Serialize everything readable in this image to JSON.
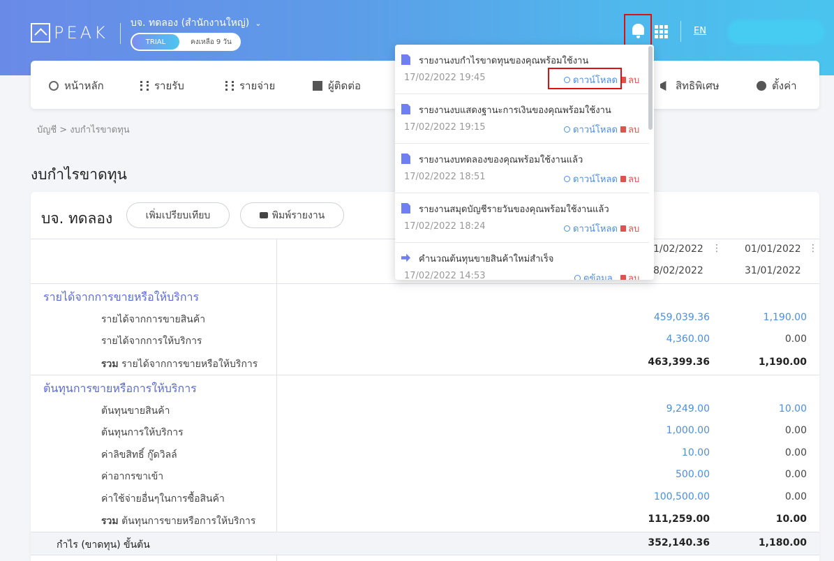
{
  "header": {
    "logo_text": "PEAK",
    "company": "บจ. ทดลอง (สำนักงานใหญ่)",
    "trial_label": "TRIAL",
    "trial_remaining": "คงเหลือ 9 วัน",
    "lang": "EN"
  },
  "nav": {
    "items": [
      {
        "label": "หน้าหลัก",
        "icon": "dashboard-icon"
      },
      {
        "label": "รายรับ",
        "icon": "coins-icon"
      },
      {
        "label": "รายจ่าย",
        "icon": "coins-icon"
      },
      {
        "label": "ผู้ติดต่อ",
        "icon": "building-icon"
      },
      {
        "label": "สิทธิพิเศษ",
        "icon": "megaphone-icon"
      },
      {
        "label": "ตั้งค่า",
        "icon": "gear-icon"
      }
    ]
  },
  "breadcrumb": "บัญชี  >  งบกำไรขาดทุน",
  "page_title": "งบกำไรขาดทุน",
  "report": {
    "company_name": "บจ. ทดลอง",
    "compare_button": "เพิ่มเปรียบเทียบ",
    "print_button": "พิมพ์รายงาน",
    "columns": [
      {
        "from": "1/02/2022",
        "to": "8/02/2022"
      },
      {
        "from": "01/01/2022",
        "to": "31/01/2022"
      }
    ],
    "sections": {
      "revenue": "รายได้จากการขายหรือให้บริการ",
      "cost": "ต้นทุนการขายหรือการให้บริการ"
    },
    "rows": {
      "rev_goods": {
        "label": "รายได้จากการขายสินค้า",
        "v1": "459,039.36",
        "v2": "1,190.00"
      },
      "rev_service": {
        "label": "รายได้จากการให้บริการ",
        "v1": "4,360.00",
        "v2": "0.00"
      },
      "rev_total": {
        "prefix": "รวม",
        "label": "รายได้จากการขายหรือให้บริการ",
        "v1": "463,399.36",
        "v2": "1,190.00"
      },
      "cost_goods": {
        "label": "ต้นทุนขายสินค้า",
        "v1": "9,249.00",
        "v2": "10.00"
      },
      "cost_service": {
        "label": "ต้นทุนการให้บริการ",
        "v1": "1,000.00",
        "v2": "0.00"
      },
      "royalty": {
        "label": "ค่าลิขสิทธิ์ กู๊ดวิลล์",
        "v1": "10.00",
        "v2": "0.00"
      },
      "import_duty": {
        "label": "ค่าอากรขาเข้า",
        "v1": "500.00",
        "v2": "0.00"
      },
      "other_purchase": {
        "label": "ค่าใช้จ่ายอื่นๆในการซื้อสินค้า",
        "v1": "100,500.00",
        "v2": "0.00"
      },
      "cost_total": {
        "prefix": "รวม",
        "label": "ต้นทุนการขายหรือการให้บริการ",
        "v1": "111,259.00",
        "v2": "10.00"
      },
      "gross": {
        "label": "กำไร (ขาดทุน) ขั้นต้น",
        "v1": "352,140.36",
        "v2": "1,180.00"
      }
    }
  },
  "notifications": {
    "download_label": "ดาวน์โหลด",
    "delete_label": "ลบ",
    "info_label": "ดูข้อมูล",
    "items": [
      {
        "text": "รายงานงบกำไรขาดทุนของคุณพร้อมใช้งาน",
        "date": "17/02/2022 19:45"
      },
      {
        "text": "รายงานงบแสดงฐานะการเงินของคุณพร้อมใช้งาน",
        "date": "17/02/2022 19:15"
      },
      {
        "text": "รายงานงบทดลองของคุณพร้อมใช้งานแล้ว",
        "date": "17/02/2022 18:51"
      },
      {
        "text": "รายงานสมุดบัญชีรายวันของคุณพร้อมใช้งานแล้ว",
        "date": "17/02/2022 18:24"
      },
      {
        "text": "คำนวณต้นทุนขายสินค้าใหม่สำเร็จ",
        "date": "17/02/2022 14:53"
      }
    ]
  }
}
